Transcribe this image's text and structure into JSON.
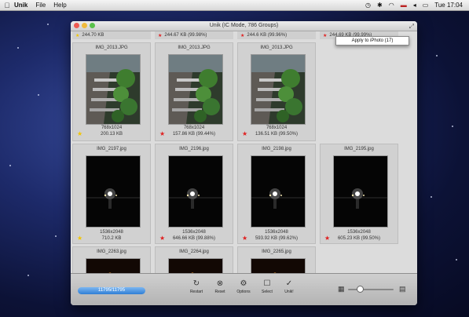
{
  "menubar": {
    "items": [
      "Unik",
      "File",
      "Help"
    ],
    "clock": "Tue 17:04",
    "status_icons": [
      "time-machine-icon",
      "bluetooth-icon",
      "wifi-icon",
      "flag-icon",
      "volume-icon",
      "battery-icon"
    ]
  },
  "window": {
    "title": "Unik (IC Mode, 786 Groups)"
  },
  "top_row": [
    {
      "size": "244.70 KB",
      "rating": "yellow"
    },
    {
      "size": "244.67 KB (99.98%)",
      "rating": "red"
    },
    {
      "size": "244.6 KB (99.96%)",
      "rating": "red"
    },
    {
      "size": "244.69 KB (99.99%)",
      "rating": "red"
    }
  ],
  "popup": {
    "label": "Apply to iPhoto (17)"
  },
  "rows": [
    {
      "cells": [
        {
          "name": "IMG_2013.JPG",
          "dims": "768x1024",
          "size": "200.13 KB",
          "rating": "yellow",
          "kind": "garden"
        },
        {
          "name": "IMG_2013.JPG",
          "dims": "768x1024",
          "size": "157.86 KB (99.44%)",
          "rating": "red",
          "kind": "garden"
        },
        {
          "name": "IMG_2013.JPG",
          "dims": "768x1024",
          "size": "136.51 KB (99.50%)",
          "rating": "red",
          "kind": "garden"
        }
      ]
    },
    {
      "cells": [
        {
          "name": "IMG_2197.jpg",
          "dims": "1536x2048",
          "size": "710.2 KB",
          "rating": "yellow",
          "kind": "night"
        },
        {
          "name": "IMG_2196.jpg",
          "dims": "1536x2048",
          "size": "646.66 KB (99.88%)",
          "rating": "red",
          "kind": "night"
        },
        {
          "name": "IMG_2198.jpg",
          "dims": "1536x2048",
          "size": "593.92 KB (99.62%)",
          "rating": "red",
          "kind": "night"
        },
        {
          "name": "IMG_2195.jpg",
          "dims": "1536x2048",
          "size": "605.23 KB (99.50%)",
          "rating": "red",
          "kind": "night"
        }
      ]
    },
    {
      "cells": [
        {
          "name": "IMG_2263.jpg",
          "kind": "lights"
        },
        {
          "name": "IMG_2264.jpg",
          "kind": "lights"
        },
        {
          "name": "IMG_2265.jpg",
          "kind": "lights"
        }
      ]
    }
  ],
  "toolbar": {
    "progress_label": "11795/11795",
    "progress_fraction": 1.0,
    "buttons": [
      {
        "label": "Restart",
        "icon": "restart-icon",
        "glyph": "↻"
      },
      {
        "label": "Reset",
        "icon": "reset-icon",
        "glyph": "⊗"
      },
      {
        "label": "Options",
        "icon": "gear-icon",
        "glyph": "⚙"
      },
      {
        "label": "Select",
        "icon": "select-icon",
        "glyph": "☐"
      },
      {
        "label": "Unik!",
        "icon": "checkmark-icon",
        "glyph": "✓"
      }
    ],
    "zoom_fraction": 0.25
  },
  "colors": {
    "star_red": "#e02020",
    "star_yellow": "#f2c500",
    "progress": "#2f7fd6"
  }
}
